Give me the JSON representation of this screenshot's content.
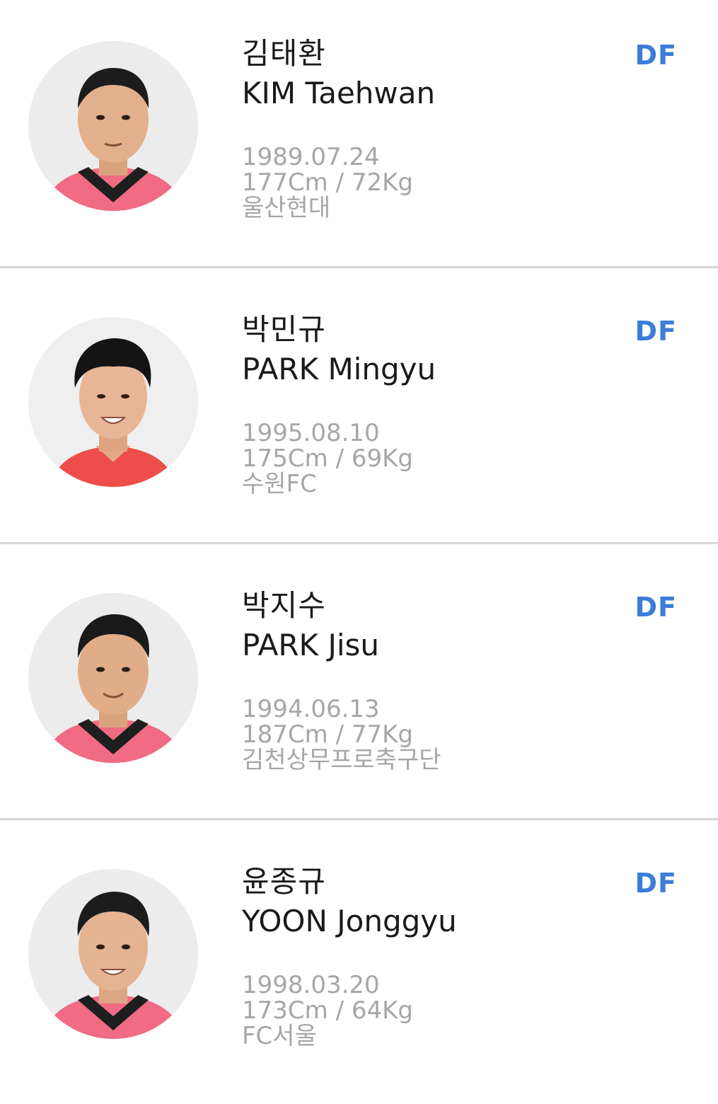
{
  "players": [
    {
      "name_ko": "김태환",
      "name_en": "KIM Taehwan",
      "position": "DF",
      "birth": "1989.07.24",
      "body": "177Cm / 72Kg",
      "club": "울산현대",
      "jersey_color": "#f06b83"
    },
    {
      "name_ko": "박민규",
      "name_en": "PARK Mingyu",
      "position": "DF",
      "birth": "1995.08.10",
      "body": "175Cm / 69Kg",
      "club": "수원FC",
      "jersey_color": "#ee4d4a"
    },
    {
      "name_ko": "박지수",
      "name_en": "PARK Jisu",
      "position": "DF",
      "birth": "1994.06.13",
      "body": "187Cm / 77Kg",
      "club": "김천상무프로축구단",
      "jersey_color": "#f06b83"
    },
    {
      "name_ko": "윤종규",
      "name_en": "YOON Jonggyu",
      "position": "DF",
      "birth": "1998.03.20",
      "body": "173Cm / 64Kg",
      "club": "FC서울",
      "jersey_color": "#f06b83"
    }
  ],
  "colors": {
    "position_accent": "#3b7dd8",
    "meta_text": "#a6a6a6",
    "divider": "#d6d6d6"
  },
  "icons": {
    "photo": "player-photo"
  }
}
